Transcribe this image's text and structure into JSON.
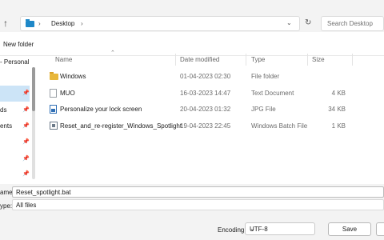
{
  "address_bar": {
    "path": "Desktop",
    "search_placeholder": "Search Desktop",
    "up_icon": "up-arrow-icon",
    "refresh_icon": "refresh-icon"
  },
  "toolbar": {
    "new_folder_label": "New folder"
  },
  "nav": {
    "items": [
      {
        "label": "- Personal"
      },
      {
        "label": "ds"
      },
      {
        "label": "ents"
      }
    ]
  },
  "columns": {
    "name": "Name",
    "date_modified": "Date modified",
    "type": "Type",
    "size": "Size"
  },
  "files": [
    {
      "name": "Windows",
      "date": "01-04-2023 02:30",
      "type": "File folder",
      "size": "",
      "icon": "folder-icon"
    },
    {
      "name": "MUO",
      "date": "16-03-2023 14:47",
      "type": "Text Document",
      "size": "4 KB",
      "icon": "text-file-icon"
    },
    {
      "name": "Personalize your lock screen",
      "date": "20-04-2023 01:32",
      "type": "JPG File",
      "size": "34 KB",
      "icon": "image-file-icon"
    },
    {
      "name": "Reset_and_re-register_Windows_Spotlight",
      "date": "19-04-2023 22:45",
      "type": "Windows Batch File",
      "size": "1 KB",
      "icon": "batch-file-icon"
    }
  ],
  "save_form": {
    "filename_label": "ame:",
    "filename_value": "Reset_spotlight.bat",
    "type_label": "ype:",
    "type_value": "All files",
    "encoding_label": "Encoding:",
    "encoding_value": "UTF-8",
    "save_label": "Save"
  },
  "colors": {
    "accent_selection": "#cce4f7",
    "folder_yellow": "#e8b73a",
    "folder_blue": "#1e88c8"
  }
}
